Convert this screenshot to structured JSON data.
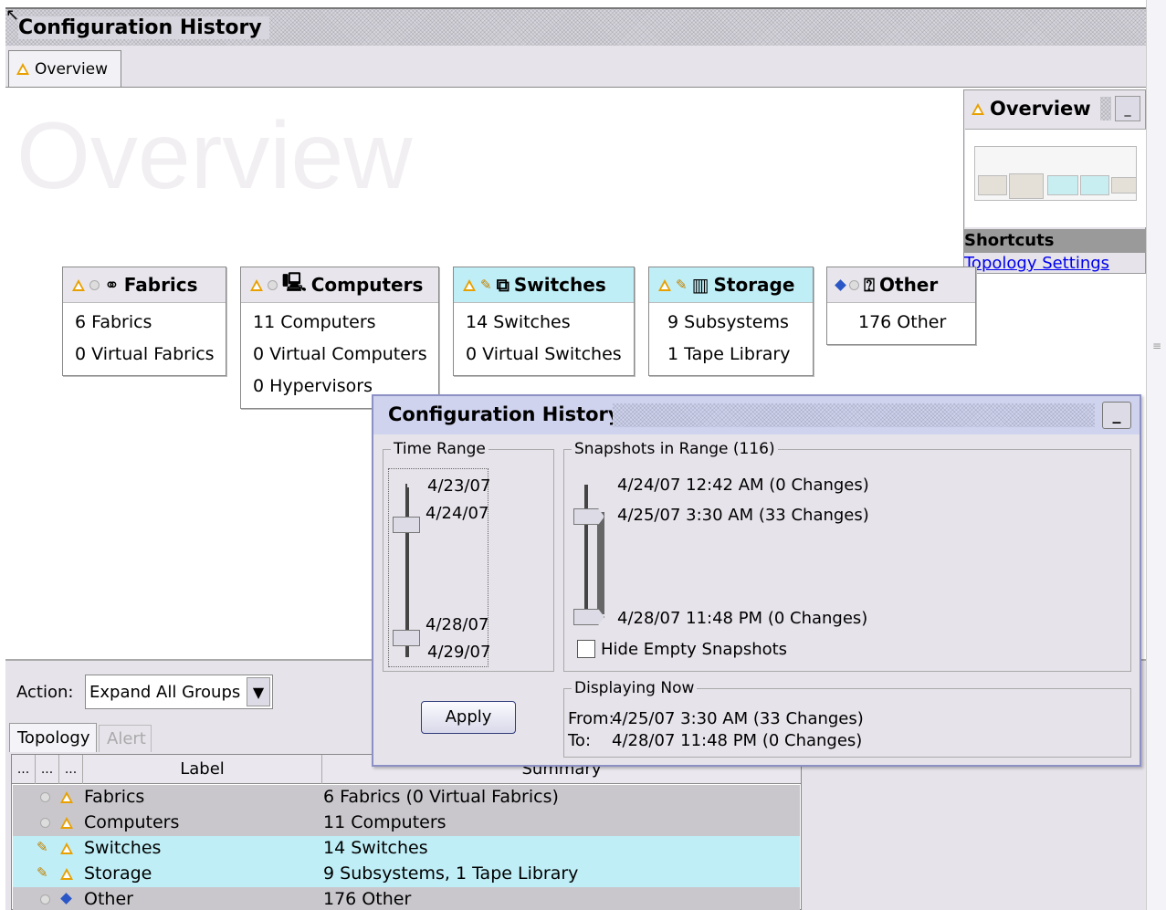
{
  "window": {
    "title": "Configuration History"
  },
  "tabs": [
    {
      "label": "Overview",
      "icon": "warning-icon"
    }
  ],
  "watermark": "Overview",
  "overview_panel": {
    "title": "Overview",
    "shortcuts_label": "Shortcuts",
    "link": "Topology Settings"
  },
  "cards": [
    {
      "title": "Fabrics",
      "lines": [
        "6 Fabrics",
        "0 Virtual Fabrics"
      ],
      "icon": "fabric-icon",
      "highlight": false
    },
    {
      "title": "Computers",
      "lines": [
        "11 Computers",
        "0 Virtual Computers",
        "0 Hypervisors"
      ],
      "icon": "computer-icon",
      "highlight": false
    },
    {
      "title": "Switches",
      "lines": [
        "14 Switches",
        "0 Virtual Switches"
      ],
      "icon": "switch-icon",
      "highlight": true
    },
    {
      "title": "Storage",
      "lines": [
        "9 Subsystems",
        "1 Tape Library"
      ],
      "icon": "storage-icon",
      "highlight": true
    },
    {
      "title": "Other",
      "lines": [
        "176 Other"
      ],
      "icon": "other-icon",
      "highlight": false
    }
  ],
  "action": {
    "label": "Action:",
    "value": "Expand All Groups"
  },
  "bottom_tabs": [
    "Topology",
    "Alert"
  ],
  "table": {
    "headers": [
      "...",
      "...",
      "...",
      "Label",
      "Summary"
    ],
    "rows": [
      {
        "label": "Fabrics",
        "summary": "6 Fabrics (0 Virtual Fabrics)",
        "highlight": false
      },
      {
        "label": "Computers",
        "summary": "11 Computers",
        "highlight": false
      },
      {
        "label": "Switches",
        "summary": "14 Switches",
        "highlight": true
      },
      {
        "label": "Storage",
        "summary": "9 Subsystems, 1 Tape Library",
        "highlight": true
      },
      {
        "label": "Other",
        "summary": "176 Other",
        "highlight": false
      }
    ]
  },
  "dialog": {
    "title": "Configuration History",
    "time_range": {
      "legend": "Time Range",
      "labels": [
        "4/23/07",
        "4/24/07",
        "4/28/07",
        "4/29/07"
      ]
    },
    "snapshots": {
      "legend": "Snapshots in Range (116)",
      "items": [
        "4/24/07 12:42 AM (0 Changes)",
        "4/25/07 3:30 AM (33 Changes)",
        "4/28/07 11:48 PM (0 Changes)"
      ],
      "hide_empty_label": "Hide Empty Snapshots",
      "hide_empty_checked": false
    },
    "apply_label": "Apply",
    "displaying": {
      "legend": "Displaying Now",
      "from_label": "From:",
      "from_value": "4/25/07 3:30 AM (33 Changes)",
      "to_label": "To:",
      "to_value": "4/28/07 11:48 PM (0 Changes)"
    }
  },
  "colors": {
    "highlight": "#bfeef6",
    "dialog_title": "#cfd3ee",
    "window_bg": "#e6e3ea",
    "link": "#0000ee"
  }
}
